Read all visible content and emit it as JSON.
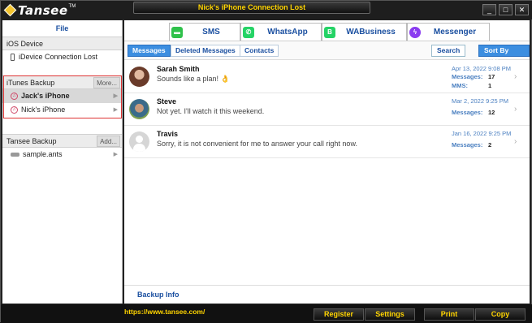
{
  "window": {
    "logo_text": "Tansee",
    "logo_tm": "TM",
    "title": "Nick's iPhone Connection Lost",
    "min_label": "_",
    "max_label": "□",
    "close_label": "✕"
  },
  "sidebar": {
    "file_label": "File",
    "ios_device_header": "iOS Device",
    "ios_device_item": "iDevice Connection Lost",
    "itunes_header": "iTunes Backup",
    "itunes_more": "More...",
    "itunes_items": [
      {
        "label": "Jack's iPhone"
      },
      {
        "label": "Nick's iPhone"
      }
    ],
    "tansee_header": "Tansee Backup",
    "tansee_add": "Add...",
    "tansee_items": [
      {
        "label": "sample.ants"
      }
    ]
  },
  "tabs": [
    {
      "label": "SMS",
      "icon": "sms-icon",
      "color": "#2fc14b"
    },
    {
      "label": "WhatsApp",
      "icon": "whatsapp-icon",
      "color": "#25d366"
    },
    {
      "label": "WABusiness",
      "icon": "wabusiness-icon",
      "color": "#25d366"
    },
    {
      "label": "Messenger",
      "icon": "messenger-icon",
      "color": "#8a3cf0"
    }
  ],
  "subtabs": {
    "messages": "Messages",
    "deleted": "Deleted Messages",
    "contacts": "Contacts",
    "search": "Search",
    "sort": "Sort By Date"
  },
  "conversations": [
    {
      "name": "Sarah Smith",
      "snippet": "Sounds like a plan! 👌",
      "date": "Apr 13, 2022 9:08 PM",
      "messages_label": "Messages:",
      "messages": "17",
      "mms_label": "MMS:",
      "mms": "1"
    },
    {
      "name": "Steve",
      "snippet": "Not yet. I'll watch it this weekend.",
      "date": "Mar 2, 2022 9:25 PM",
      "messages_label": "Messages:",
      "messages": "12"
    },
    {
      "name": "Travis",
      "snippet": "Sorry, it is not convenient for me to answer your call right now.",
      "date": "Jan 16, 2022 9:25 PM",
      "messages_label": "Messages:",
      "messages": "2"
    }
  ],
  "backup_info": "Backup Info",
  "bottom": {
    "url": "https://www.tansee.com/",
    "register": "Register",
    "settings": "Settings",
    "print": "Print",
    "copy": "Copy"
  },
  "colors": {
    "accent": "#3c8ee0",
    "brand_yellow": "#ffd400",
    "highlight_border": "#dd3333"
  }
}
